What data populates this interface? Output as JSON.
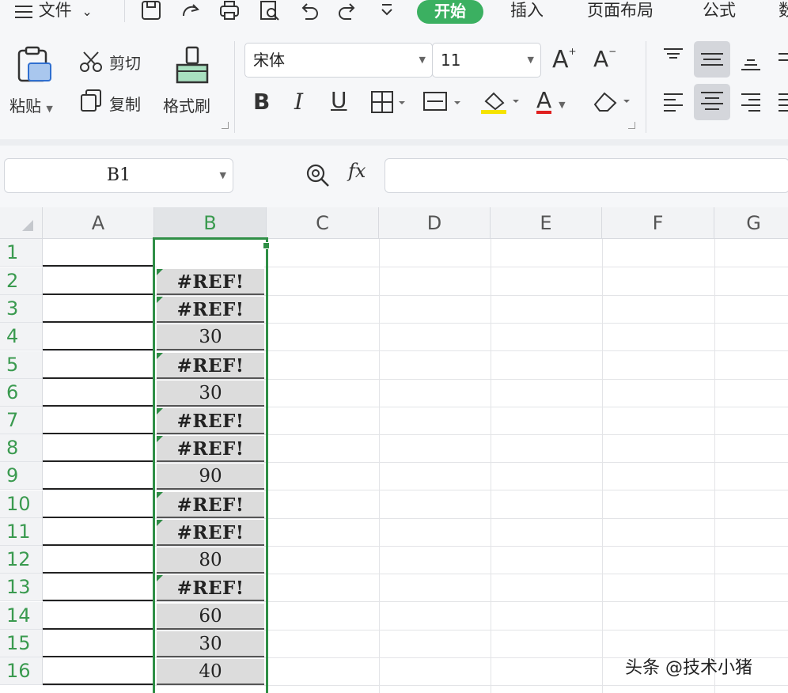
{
  "menubar": {
    "file_label": "文件",
    "tabs": [
      "开始",
      "插入",
      "页面布局",
      "公式",
      "数"
    ]
  },
  "ribbon": {
    "paste_label": "粘贴",
    "cut_label": "剪切",
    "copy_label": "复制",
    "format_painter_label": "格式刷",
    "font_name": "宋体",
    "font_size": "11",
    "bold": "B",
    "italic": "I",
    "underline": "U",
    "increase_font": "A",
    "decrease_font": "A",
    "font_color_glyph": "A",
    "accent_color": "#3bb061",
    "font_color": "#e02020",
    "fill_color": "#f5e300"
  },
  "formula_bar": {
    "cell_reference": "B1",
    "fx_label": "fx",
    "formula": ""
  },
  "sheet": {
    "columns": [
      "A",
      "B",
      "C",
      "D",
      "E",
      "F",
      "G"
    ],
    "selected_column": "B",
    "rows": [
      "1",
      "2",
      "3",
      "4",
      "5",
      "6",
      "7",
      "8",
      "9",
      "10",
      "11",
      "12",
      "13",
      "14",
      "15",
      "16"
    ],
    "column_b_values": [
      "",
      "#REF!",
      "#REF!",
      "30",
      "#REF!",
      "30",
      "#REF!",
      "#REF!",
      "90",
      "#REF!",
      "#REF!",
      "80",
      "#REF!",
      "60",
      "30",
      "40"
    ],
    "selection_color": "#2f8f46"
  },
  "watermark": "头条 @技术小猪"
}
